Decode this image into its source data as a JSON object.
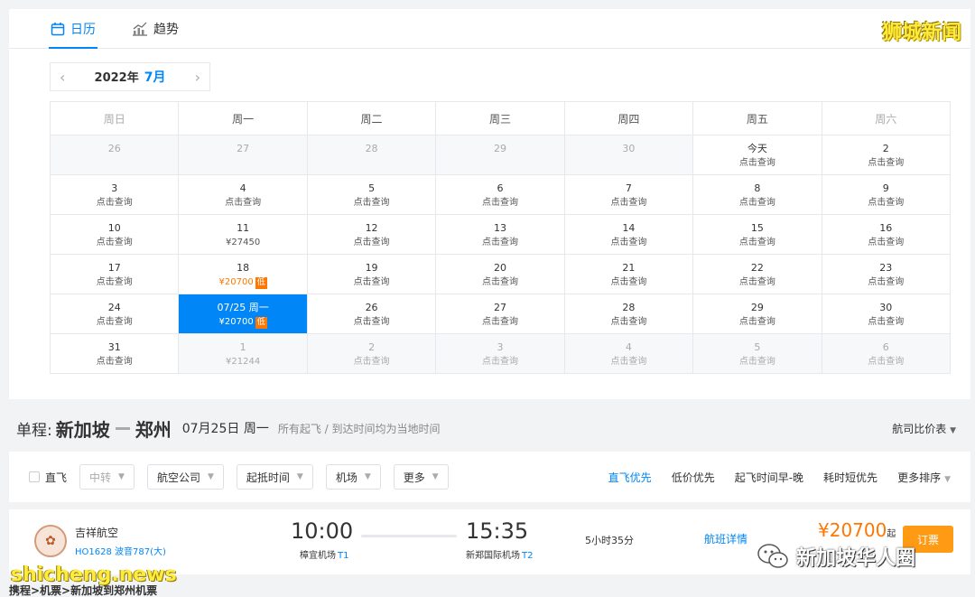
{
  "tabs": [
    {
      "label": "日历"
    },
    {
      "label": "趋势"
    }
  ],
  "watermark_top": "狮城新闻",
  "month": {
    "year": "2022年",
    "month": "7月"
  },
  "weekdays": [
    "周日",
    "周一",
    "周二",
    "周三",
    "周四",
    "周五",
    "周六"
  ],
  "rows": [
    [
      {
        "d": "26",
        "s": "",
        "out": true
      },
      {
        "d": "27",
        "s": "",
        "out": true
      },
      {
        "d": "28",
        "s": "",
        "out": true
      },
      {
        "d": "29",
        "s": "",
        "out": true
      },
      {
        "d": "30",
        "s": "",
        "out": true
      },
      {
        "d": "今天",
        "s": "点击查询"
      },
      {
        "d": "2",
        "s": "点击查询"
      }
    ],
    [
      {
        "d": "3",
        "s": "点击查询"
      },
      {
        "d": "4",
        "s": "点击查询"
      },
      {
        "d": "5",
        "s": "点击查询"
      },
      {
        "d": "6",
        "s": "点击查询"
      },
      {
        "d": "7",
        "s": "点击查询"
      },
      {
        "d": "8",
        "s": "点击查询"
      },
      {
        "d": "9",
        "s": "点击查询"
      }
    ],
    [
      {
        "d": "10",
        "s": "点击查询"
      },
      {
        "d": "11",
        "s": "¥27450"
      },
      {
        "d": "12",
        "s": "点击查询"
      },
      {
        "d": "13",
        "s": "点击查询"
      },
      {
        "d": "14",
        "s": "点击查询"
      },
      {
        "d": "15",
        "s": "点击查询"
      },
      {
        "d": "16",
        "s": "点击查询"
      }
    ],
    [
      {
        "d": "17",
        "s": "点击查询"
      },
      {
        "d": "18",
        "s": "¥20700",
        "badge": "低",
        "low": true
      },
      {
        "d": "19",
        "s": "点击查询"
      },
      {
        "d": "20",
        "s": "点击查询"
      },
      {
        "d": "21",
        "s": "点击查询"
      },
      {
        "d": "22",
        "s": "点击查询"
      },
      {
        "d": "23",
        "s": "点击查询"
      }
    ],
    [
      {
        "d": "24",
        "s": "点击查询"
      },
      {
        "d": "07/25 周一",
        "s": "¥20700",
        "badge": "低",
        "sel": true
      },
      {
        "d": "26",
        "s": "点击查询"
      },
      {
        "d": "27",
        "s": "点击查询"
      },
      {
        "d": "28",
        "s": "点击查询"
      },
      {
        "d": "29",
        "s": "点击查询"
      },
      {
        "d": "30",
        "s": "点击查询"
      }
    ],
    [
      {
        "d": "31",
        "s": "点击查询"
      },
      {
        "d": "1",
        "s": "¥21244",
        "out": true
      },
      {
        "d": "2",
        "s": "点击查询",
        "out": true
      },
      {
        "d": "3",
        "s": "点击查询",
        "out": true
      },
      {
        "d": "4",
        "s": "点击查询",
        "out": true
      },
      {
        "d": "5",
        "s": "点击查询",
        "out": true
      },
      {
        "d": "6",
        "s": "点击查询",
        "out": true
      }
    ]
  ],
  "route": {
    "label": "单程:",
    "from": "新加坡",
    "to": "郑州",
    "date": "07月25日 周一",
    "note": "所有起飞 / 到达时间均为当地时间",
    "compare": "航司比价表"
  },
  "filters": {
    "direct": "直飞",
    "dropdowns": [
      "中转",
      "航空公司",
      "起抵时间",
      "机场",
      "更多"
    ],
    "sorts": [
      "直飞优先",
      "低价优先",
      "起飞时间早-晚",
      "耗时短优先",
      "更多排序"
    ]
  },
  "flight": {
    "airline": "吉祥航空",
    "number": "HO1628 波音787(大)",
    "dep_time": "10:00",
    "dep_airport": "樟宜机场",
    "dep_terminal": "T1",
    "arr_time": "15:35",
    "arr_airport": "新郑国际机场",
    "arr_terminal": "T2",
    "duration": "5小时35分",
    "details": "航班详情",
    "price": "¥20700",
    "price_suffix": "起",
    "book": "订票"
  },
  "watermarks": {
    "group": "新加坡华人圈",
    "site": "shicheng.news"
  },
  "breadcrumb": "携程>机票>新加坡到郑州机票"
}
